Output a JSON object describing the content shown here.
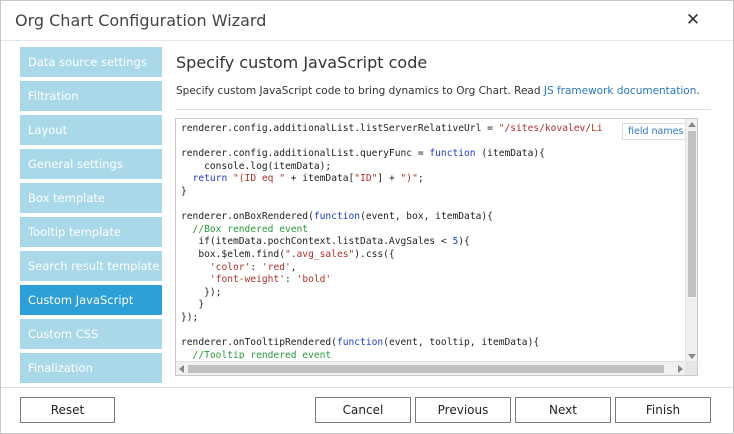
{
  "window": {
    "title": "Org Chart Configuration Wizard",
    "close_glyph": "✕"
  },
  "sidebar": {
    "items": [
      {
        "label": "Data source settings",
        "active": false
      },
      {
        "label": "Filtration",
        "active": false
      },
      {
        "label": "Layout",
        "active": false
      },
      {
        "label": "General settings",
        "active": false
      },
      {
        "label": "Box template",
        "active": false
      },
      {
        "label": "Tooltip template",
        "active": false
      },
      {
        "label": "Search result template",
        "active": false
      },
      {
        "label": "Custom JavaScript",
        "active": true
      },
      {
        "label": "Custom CSS",
        "active": false
      },
      {
        "label": "Finalization",
        "active": false
      }
    ]
  },
  "main": {
    "heading": "Specify custom JavaScript code",
    "description_text": "Specify custom JavaScript code to bring dynamics to Org Chart. Read ",
    "description_link": "JS framework documentation",
    "description_end": ".",
    "field_names_label": "field names",
    "code_lines": [
      "renderer.config.additionalList.listServerRelativeUrl = \"/sites/kovalev/Li",
      "",
      "renderer.config.additionalList.queryFunc = function (itemData){",
      "    console.log(itemData);",
      "  return \"(ID eq \" + itemData[\"ID\"] + \")\";",
      "}",
      "",
      "renderer.onBoxRendered(function(event, box, itemData){",
      "  //Box rendered event",
      "   if(itemData.pochContext.listData.AvgSales < 5){",
      "   box.$elem.find(\".avg_sales\").css({",
      "     'color': 'red',",
      "     'font-weight': 'bold'",
      "    });",
      "   }",
      "});",
      "",
      "renderer.onTooltipRendered(function(event, tooltip, itemData){",
      "  //Tooltip rendered event"
    ]
  },
  "footer": {
    "reset_label": "Reset",
    "cancel_label": "Cancel",
    "previous_label": "Previous",
    "next_label": "Next",
    "finish_label": "Finish"
  },
  "colors": {
    "sidebar_item": "#a9d8e8",
    "sidebar_active": "#2b9fd6",
    "link": "#2b78c2"
  }
}
